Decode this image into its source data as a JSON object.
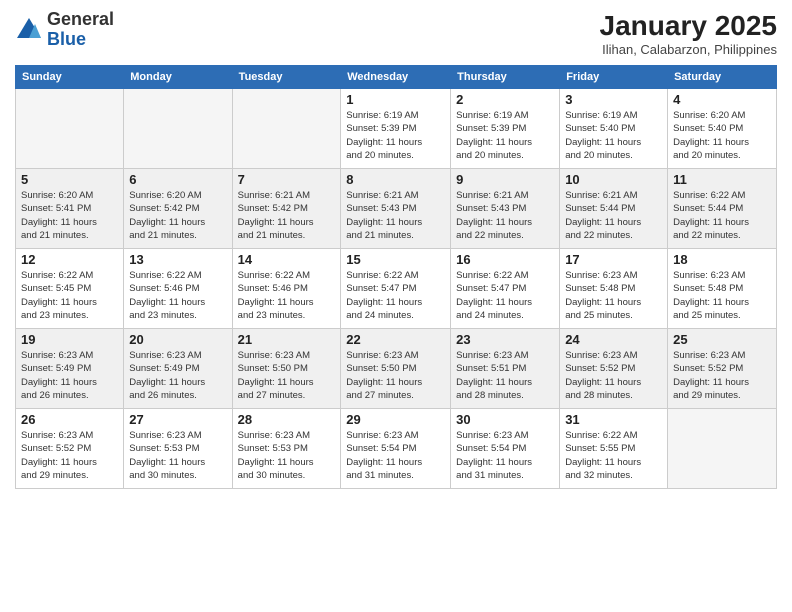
{
  "logo": {
    "general": "General",
    "blue": "Blue"
  },
  "title": "January 2025",
  "subtitle": "Ilihan, Calabarzon, Philippines",
  "weekdays": [
    "Sunday",
    "Monday",
    "Tuesday",
    "Wednesday",
    "Thursday",
    "Friday",
    "Saturday"
  ],
  "rows": [
    [
      {
        "day": "",
        "info": ""
      },
      {
        "day": "",
        "info": ""
      },
      {
        "day": "",
        "info": ""
      },
      {
        "day": "1",
        "info": "Sunrise: 6:19 AM\nSunset: 5:39 PM\nDaylight: 11 hours\nand 20 minutes."
      },
      {
        "day": "2",
        "info": "Sunrise: 6:19 AM\nSunset: 5:39 PM\nDaylight: 11 hours\nand 20 minutes."
      },
      {
        "day": "3",
        "info": "Sunrise: 6:19 AM\nSunset: 5:40 PM\nDaylight: 11 hours\nand 20 minutes."
      },
      {
        "day": "4",
        "info": "Sunrise: 6:20 AM\nSunset: 5:40 PM\nDaylight: 11 hours\nand 20 minutes."
      }
    ],
    [
      {
        "day": "5",
        "info": "Sunrise: 6:20 AM\nSunset: 5:41 PM\nDaylight: 11 hours\nand 21 minutes."
      },
      {
        "day": "6",
        "info": "Sunrise: 6:20 AM\nSunset: 5:42 PM\nDaylight: 11 hours\nand 21 minutes."
      },
      {
        "day": "7",
        "info": "Sunrise: 6:21 AM\nSunset: 5:42 PM\nDaylight: 11 hours\nand 21 minutes."
      },
      {
        "day": "8",
        "info": "Sunrise: 6:21 AM\nSunset: 5:43 PM\nDaylight: 11 hours\nand 21 minutes."
      },
      {
        "day": "9",
        "info": "Sunrise: 6:21 AM\nSunset: 5:43 PM\nDaylight: 11 hours\nand 22 minutes."
      },
      {
        "day": "10",
        "info": "Sunrise: 6:21 AM\nSunset: 5:44 PM\nDaylight: 11 hours\nand 22 minutes."
      },
      {
        "day": "11",
        "info": "Sunrise: 6:22 AM\nSunset: 5:44 PM\nDaylight: 11 hours\nand 22 minutes."
      }
    ],
    [
      {
        "day": "12",
        "info": "Sunrise: 6:22 AM\nSunset: 5:45 PM\nDaylight: 11 hours\nand 23 minutes."
      },
      {
        "day": "13",
        "info": "Sunrise: 6:22 AM\nSunset: 5:46 PM\nDaylight: 11 hours\nand 23 minutes."
      },
      {
        "day": "14",
        "info": "Sunrise: 6:22 AM\nSunset: 5:46 PM\nDaylight: 11 hours\nand 23 minutes."
      },
      {
        "day": "15",
        "info": "Sunrise: 6:22 AM\nSunset: 5:47 PM\nDaylight: 11 hours\nand 24 minutes."
      },
      {
        "day": "16",
        "info": "Sunrise: 6:22 AM\nSunset: 5:47 PM\nDaylight: 11 hours\nand 24 minutes."
      },
      {
        "day": "17",
        "info": "Sunrise: 6:23 AM\nSunset: 5:48 PM\nDaylight: 11 hours\nand 25 minutes."
      },
      {
        "day": "18",
        "info": "Sunrise: 6:23 AM\nSunset: 5:48 PM\nDaylight: 11 hours\nand 25 minutes."
      }
    ],
    [
      {
        "day": "19",
        "info": "Sunrise: 6:23 AM\nSunset: 5:49 PM\nDaylight: 11 hours\nand 26 minutes."
      },
      {
        "day": "20",
        "info": "Sunrise: 6:23 AM\nSunset: 5:49 PM\nDaylight: 11 hours\nand 26 minutes."
      },
      {
        "day": "21",
        "info": "Sunrise: 6:23 AM\nSunset: 5:50 PM\nDaylight: 11 hours\nand 27 minutes."
      },
      {
        "day": "22",
        "info": "Sunrise: 6:23 AM\nSunset: 5:50 PM\nDaylight: 11 hours\nand 27 minutes."
      },
      {
        "day": "23",
        "info": "Sunrise: 6:23 AM\nSunset: 5:51 PM\nDaylight: 11 hours\nand 28 minutes."
      },
      {
        "day": "24",
        "info": "Sunrise: 6:23 AM\nSunset: 5:52 PM\nDaylight: 11 hours\nand 28 minutes."
      },
      {
        "day": "25",
        "info": "Sunrise: 6:23 AM\nSunset: 5:52 PM\nDaylight: 11 hours\nand 29 minutes."
      }
    ],
    [
      {
        "day": "26",
        "info": "Sunrise: 6:23 AM\nSunset: 5:52 PM\nDaylight: 11 hours\nand 29 minutes."
      },
      {
        "day": "27",
        "info": "Sunrise: 6:23 AM\nSunset: 5:53 PM\nDaylight: 11 hours\nand 30 minutes."
      },
      {
        "day": "28",
        "info": "Sunrise: 6:23 AM\nSunset: 5:53 PM\nDaylight: 11 hours\nand 30 minutes."
      },
      {
        "day": "29",
        "info": "Sunrise: 6:23 AM\nSunset: 5:54 PM\nDaylight: 11 hours\nand 31 minutes."
      },
      {
        "day": "30",
        "info": "Sunrise: 6:23 AM\nSunset: 5:54 PM\nDaylight: 11 hours\nand 31 minutes."
      },
      {
        "day": "31",
        "info": "Sunrise: 6:22 AM\nSunset: 5:55 PM\nDaylight: 11 hours\nand 32 minutes."
      },
      {
        "day": "",
        "info": ""
      }
    ]
  ]
}
